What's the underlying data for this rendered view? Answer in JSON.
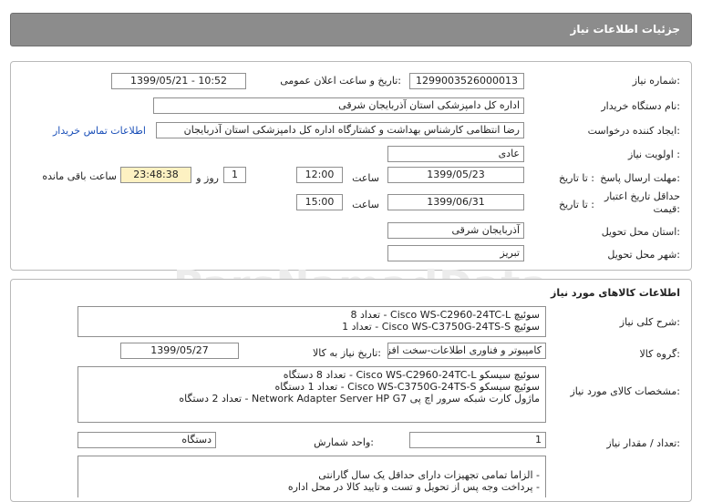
{
  "header": {
    "title": "جزئیات اطلاعات نیاز"
  },
  "watermark": "ParsNamadData",
  "need_info": {
    "need_number_label": "شماره نیاز:",
    "need_number": "1299003526000013",
    "announce_label": "تاریخ و ساعت اعلان عمومی:",
    "announce_value": "1399/05/21 - 10:52",
    "buyer_label": "نام دستگاه خریدار:",
    "buyer_value": "اداره کل دامپزشکی استان آذربایجان شرقی",
    "creator_label": "ایجاد کننده درخواست:",
    "creator_value": "رضا انتظامی کارشناس بهداشت و کشتارگاه اداره کل دامپزشکی استان آذربایجان",
    "contact_link": "اطلاعات تماس خریدار",
    "priority_label": "اولویت نیاز :",
    "priority_value": "عادی",
    "deadline_label": "مهلت ارسال پاسخ:",
    "to_date_label": "تا تاریخ :",
    "deadline_date": "1399/05/23",
    "time_label": "ساعت",
    "deadline_time": "12:00",
    "days_value": "1",
    "days_label": "روز و",
    "remaining_time": "23:48:38",
    "remaining_label": "ساعت باقی مانده",
    "validity_label_1": "حداقل تاریخ اعتبار",
    "validity_label_2": "قیمت:",
    "validity_to_label": "تا تاریخ :",
    "validity_date": "1399/06/31",
    "validity_time_label": "ساعت",
    "validity_time": "15:00",
    "province_label": "استان محل تحویل:",
    "province_value": "آذربایجان شرقی",
    "city_label": "شهر محل تحویل:",
    "city_value": "تبریز"
  },
  "goods": {
    "section_title": "اطلاعات کالاهای مورد نیاز",
    "summary_label": "شرح کلی نیاز:",
    "summary_lines": [
      "سوئیچ Cisco WS-C2960-24TC-L - تعداد 8",
      "سوئیچ Cisco WS-C3750G-24TS-S - تعداد 1"
    ],
    "group_label": "گروه کالا:",
    "group_value": "کامپیوتر و فناوری اطلاعات-سخت افزار",
    "need_date_label": "تاریخ نیاز به کالا:",
    "need_date": "1399/05/27",
    "spec_label": "مشخصات کالای مورد نیاز:",
    "spec_lines": [
      "سوئیچ سیسکو Cisco WS-C2960-24TC-L - تعداد 8 دستگاه",
      "سوئیچ سیسکو Cisco WS-C3750G-24TS-S - تعداد 1 دستگاه",
      "ماژول کارت شبکه سرور اچ پی  Network Adapter Server HP G7   - تعداد 2 دستگاه"
    ],
    "qty_label": "تعداد / مقدار نیاز:",
    "qty_value": "1",
    "unit_label": "واحد شمارش:",
    "unit_value": "دستگاه",
    "notes_lines": [
      "- الزاما تمامی تجهیزات دارای حداقل یک سال گارانتی",
      "- پرداخت وجه پس از تحویل و تست و تایید کالا در محل اداره"
    ]
  }
}
